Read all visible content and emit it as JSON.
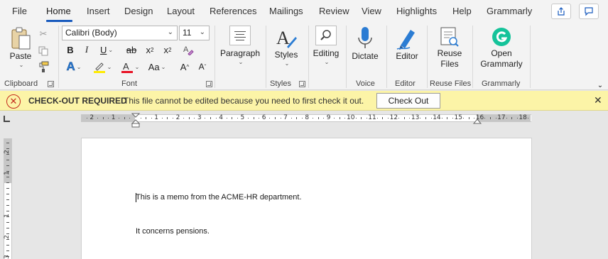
{
  "menu": {
    "tabs": [
      "File",
      "Home",
      "Insert",
      "Design",
      "Layout",
      "References",
      "Mailings",
      "Review",
      "View",
      "Highlights",
      "Help",
      "Grammarly"
    ],
    "active_tab": "Home"
  },
  "ribbon": {
    "clipboard": {
      "paste_label": "Paste",
      "group_label": "Clipboard"
    },
    "font": {
      "font_name": "Calibri (Body)",
      "font_size": "11",
      "bold": "B",
      "italic": "I",
      "underline": "U",
      "strike": "ab",
      "subscript": "x",
      "subscript_mark": "2",
      "superscript": "x",
      "superscript_mark": "2",
      "change_case": "Aa",
      "grow": "A",
      "shrink": "A",
      "group_label": "Font",
      "font_color": "#e81123",
      "highlight_color": "#ffeb00"
    },
    "paragraph": {
      "label": "Paragraph"
    },
    "styles": {
      "label": "Styles",
      "group_label": "Styles"
    },
    "editing": {
      "label": "Editing"
    },
    "voice": {
      "dictate_label": "Dictate",
      "group_label": "Voice"
    },
    "editor": {
      "label": "Editor",
      "group_label": "Editor"
    },
    "reuse_files": {
      "label_line1": "Reuse",
      "label_line2": "Files",
      "group_label": "Reuse Files"
    },
    "grammarly": {
      "label_line1": "Open",
      "label_line2": "Grammarly",
      "group_label": "Grammarly",
      "brand_color": "#15c39a"
    }
  },
  "notification": {
    "title": "CHECK-OUT REQUIRED",
    "message": "This file cannot be edited because you need to first check it out.",
    "button_label": "Check Out"
  },
  "ruler": {
    "labels": [
      "2",
      "1",
      "1",
      "2",
      "3",
      "4",
      "5",
      "6",
      "7",
      "8",
      "9",
      "10",
      "11",
      "12",
      "13",
      "14",
      "15",
      "16",
      "17",
      "18"
    ],
    "vertical_labels": [
      "2",
      "1",
      "1",
      "2",
      "3"
    ]
  },
  "document": {
    "lines": [
      "This is a memo from the ACME-HR department.",
      "It concerns pensions."
    ]
  }
}
